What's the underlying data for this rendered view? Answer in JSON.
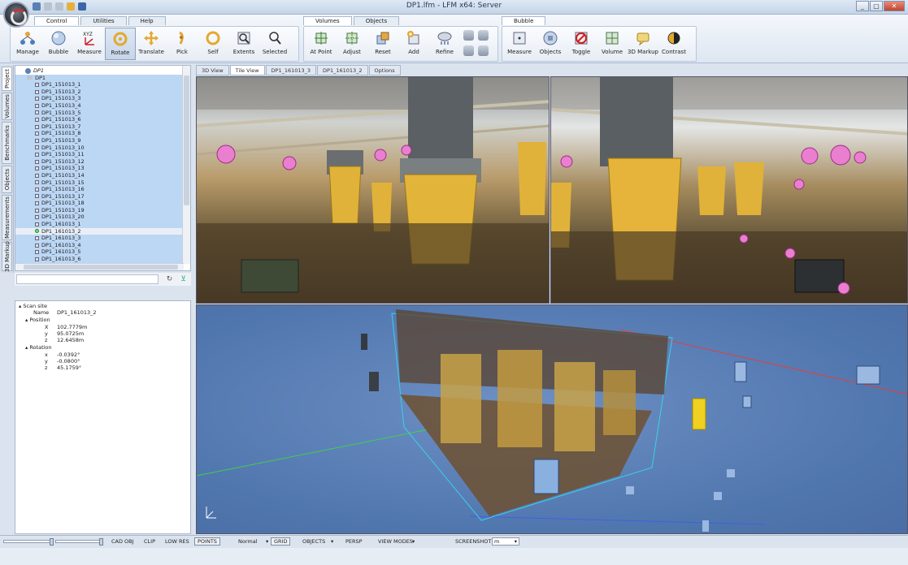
{
  "window": {
    "title": "DP1.lfm - LFM x64: Server",
    "controls": [
      "_",
      "▢",
      "✕"
    ]
  },
  "ribbon": {
    "left_tabs": [
      "Control",
      "Utilities",
      "Help"
    ],
    "mid_tabs": [
      "Volumes",
      "Objects"
    ],
    "right_tabs": [
      "Bubble"
    ],
    "control_buttons": [
      {
        "label": "Manage",
        "icon": "manage-icon"
      },
      {
        "label": "Bubble",
        "icon": "bubble-icon"
      },
      {
        "label": "Measure",
        "icon": "measure-xyz-icon",
        "icon_text": "XYZ"
      },
      {
        "label": "Rotate",
        "icon": "rotate-icon"
      },
      {
        "label": "Translate",
        "icon": "translate-icon"
      },
      {
        "label": "Pick",
        "icon": "pick-icon"
      },
      {
        "label": "Self",
        "icon": "self-icon"
      },
      {
        "label": "Extents",
        "icon": "extents-icon"
      },
      {
        "label": "Selected",
        "icon": "selected-icon"
      }
    ],
    "volume_buttons": [
      {
        "label": "At Point",
        "icon": "at-point-icon"
      },
      {
        "label": "Adjust",
        "icon": "adjust-icon"
      },
      {
        "label": "Reset",
        "icon": "reset-icon"
      },
      {
        "label": "Add",
        "icon": "add-icon"
      },
      {
        "label": "Refine",
        "icon": "refine-icon"
      }
    ],
    "bubble_buttons": [
      {
        "label": "Measure",
        "icon": "measure-icon"
      },
      {
        "label": "Objects",
        "icon": "objects-icon"
      },
      {
        "label": "Toggle",
        "icon": "toggle-icon"
      },
      {
        "label": "Volume",
        "icon": "volume-icon"
      },
      {
        "label": "3D Markup",
        "icon": "markup-icon"
      },
      {
        "label": "Contrast",
        "icon": "contrast-icon"
      }
    ]
  },
  "side_tabs": [
    "Project",
    "Volumes",
    "Benchmarks",
    "Objects",
    "Measurements",
    "3D Markup"
  ],
  "tree": {
    "root": "DP1",
    "child": "DP1",
    "items": [
      "DP1_151013_1",
      "DP1_151013_2",
      "DP1_151013_3",
      "DP1_151013_4",
      "DP1_151013_5",
      "DP1_151013_6",
      "DP1_151013_7",
      "DP1_151013_8",
      "DP1_151013_9",
      "DP1_151013_10",
      "DP1_151013_11",
      "DP1_151013_12",
      "DP1_151013_13",
      "DP1_151013_14",
      "DP1_151013_15",
      "DP1_151013_16",
      "DP1_151013_17",
      "DP1_151013_18",
      "DP1_151013_19",
      "DP1_151013_20",
      "DP1_161013_1",
      "DP1_161013_2",
      "DP1_161013_3",
      "DP1_161013_4",
      "DP1_161013_5",
      "DP1_161013_6"
    ],
    "selected_index": 21
  },
  "properties": {
    "section": "Scan site",
    "name_label": "Name",
    "name_value": "DP1_161013_2",
    "position_label": "Position",
    "px_label": "X",
    "px_value": "102.7779m",
    "py_label": "y",
    "py_value": "95.0725m",
    "pz_label": "z",
    "pz_value": "12.6458m",
    "rotation_label": "Rotation",
    "rx_label": "x",
    "rx_value": "-0.0392°",
    "ry_label": "y",
    "ry_value": "-0.0800°",
    "rz_label": "z",
    "rz_value": "45.1759°"
  },
  "view_tabs": [
    "3D View",
    "Tile View",
    "DP1_161013_3",
    "DP1_161013_2",
    "Options"
  ],
  "active_view_tab": 1,
  "status": {
    "cad_obj": "CAD OBJ",
    "clip": "CLIP",
    "low_res": "LOW RES",
    "points": "POINTS",
    "normal": "Normal",
    "grid": "GRID",
    "objects": "OBJECTS",
    "persp": "PERSP",
    "view_modes": "VIEW MODES",
    "screenshot": "SCREENSHOT",
    "unit": "m"
  }
}
